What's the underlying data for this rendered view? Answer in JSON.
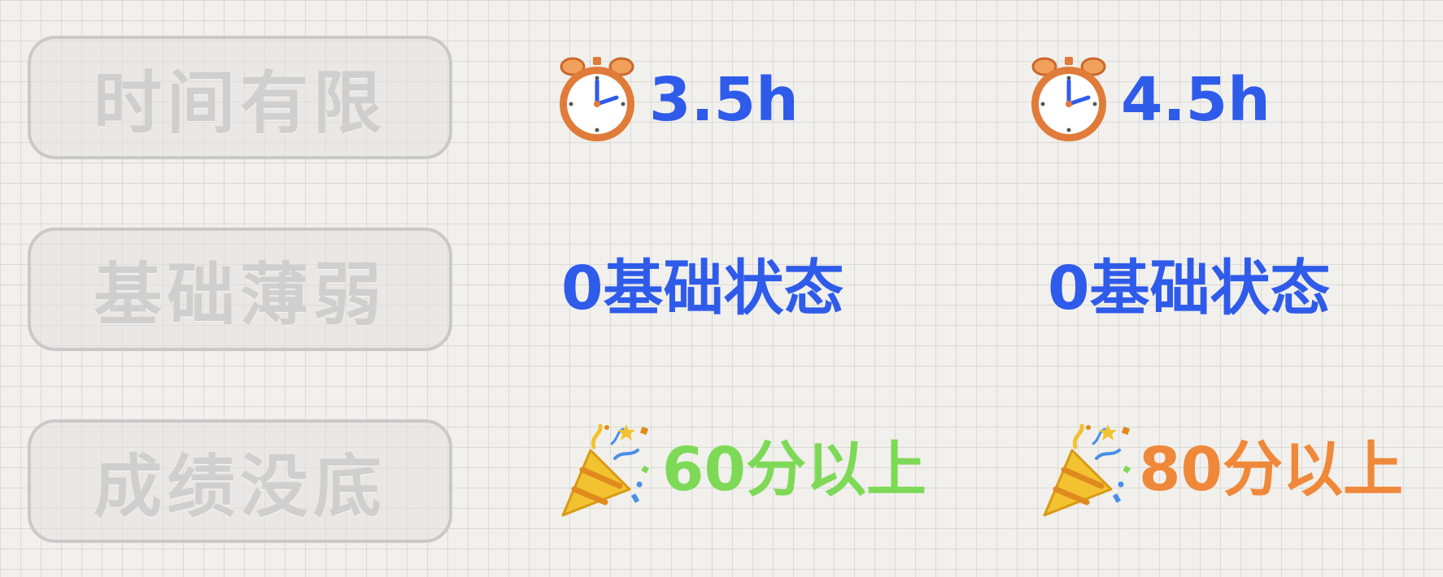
{
  "rows": [
    {
      "label": "时间有限",
      "left": {
        "icon": "alarm-clock-icon",
        "value": "3.5h"
      },
      "right": {
        "icon": "alarm-clock-icon",
        "value": "4.5h"
      }
    },
    {
      "label": "基础薄弱",
      "left": {
        "value": "0基础状态"
      },
      "right": {
        "value": "0基础状态"
      }
    },
    {
      "label": "成绩没底",
      "left": {
        "icon": "party-popper-icon",
        "value": "60分以上"
      },
      "right": {
        "icon": "party-popper-icon",
        "value": "80分以上"
      }
    }
  ],
  "colors": {
    "blue": "#2f5bea",
    "green": "#7ed957",
    "orange": "#f0883a",
    "label_gray": "#cfcfcf"
  }
}
